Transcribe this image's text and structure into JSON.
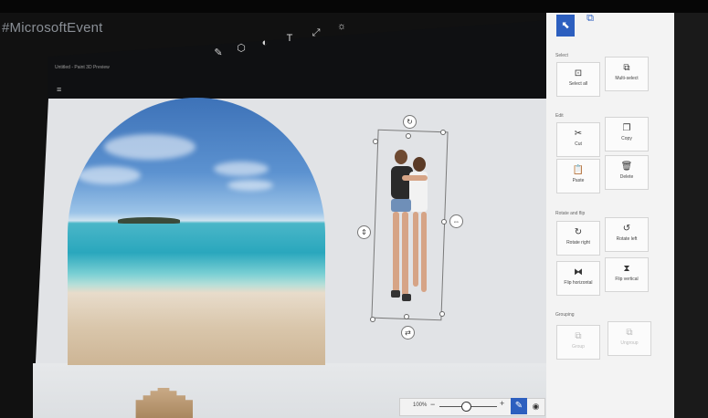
{
  "overlay": {
    "hashtag": "#MicrosoftEvent"
  },
  "app": {
    "title": "Untitled - Paint 3D Preview"
  },
  "toolbar": {
    "tools": [
      {
        "name": "brushes-icon",
        "glyph": "✎"
      },
      {
        "name": "3d-objects-icon",
        "glyph": "⬡"
      },
      {
        "name": "stickers-icon",
        "glyph": "◐"
      },
      {
        "name": "text-icon",
        "glyph": "T"
      },
      {
        "name": "effects-icon",
        "glyph": "⤢"
      },
      {
        "name": "canvas-settings-icon",
        "glyph": "☼"
      }
    ]
  },
  "panel": {
    "tabs": [
      {
        "name": "select-tab",
        "glyph": "⬉"
      },
      {
        "name": "crop-tab",
        "glyph": "⧉"
      }
    ],
    "sections": {
      "select": "Select",
      "edit": "Edit",
      "rotate": "Rotate and flip",
      "grouping": "Grouping"
    },
    "buttons": {
      "select_all": {
        "label": "Select all",
        "glyph": "⊡"
      },
      "multi_select": {
        "label": "Multi-select",
        "glyph": "⧉"
      },
      "cut": {
        "label": "Cut",
        "glyph": "✂"
      },
      "copy": {
        "label": "Copy",
        "glyph": "❐"
      },
      "paste": {
        "label": "Paste",
        "glyph": "📋"
      },
      "delete": {
        "label": "Delete",
        "glyph": "🗑"
      },
      "rotate_right": {
        "label": "Rotate right",
        "glyph": "↻"
      },
      "rotate_left": {
        "label": "Rotate left",
        "glyph": "↺"
      },
      "flip_horizontal": {
        "label": "Flip horizontal",
        "glyph": "⧓"
      },
      "flip_vertical": {
        "label": "Flip vertical",
        "glyph": "⧗"
      },
      "group": {
        "label": "Group",
        "glyph": "⧉"
      },
      "ungroup": {
        "label": "Ungroup",
        "glyph": "⧉"
      }
    }
  },
  "zoom": {
    "value": "100%",
    "minus": "−",
    "plus": "+",
    "level": 0.45
  },
  "colors": {
    "accent": "#2d5fbf",
    "panel": "#f3f3f3",
    "canvas": "#e1e3e6",
    "appbar": "#0f1012"
  }
}
